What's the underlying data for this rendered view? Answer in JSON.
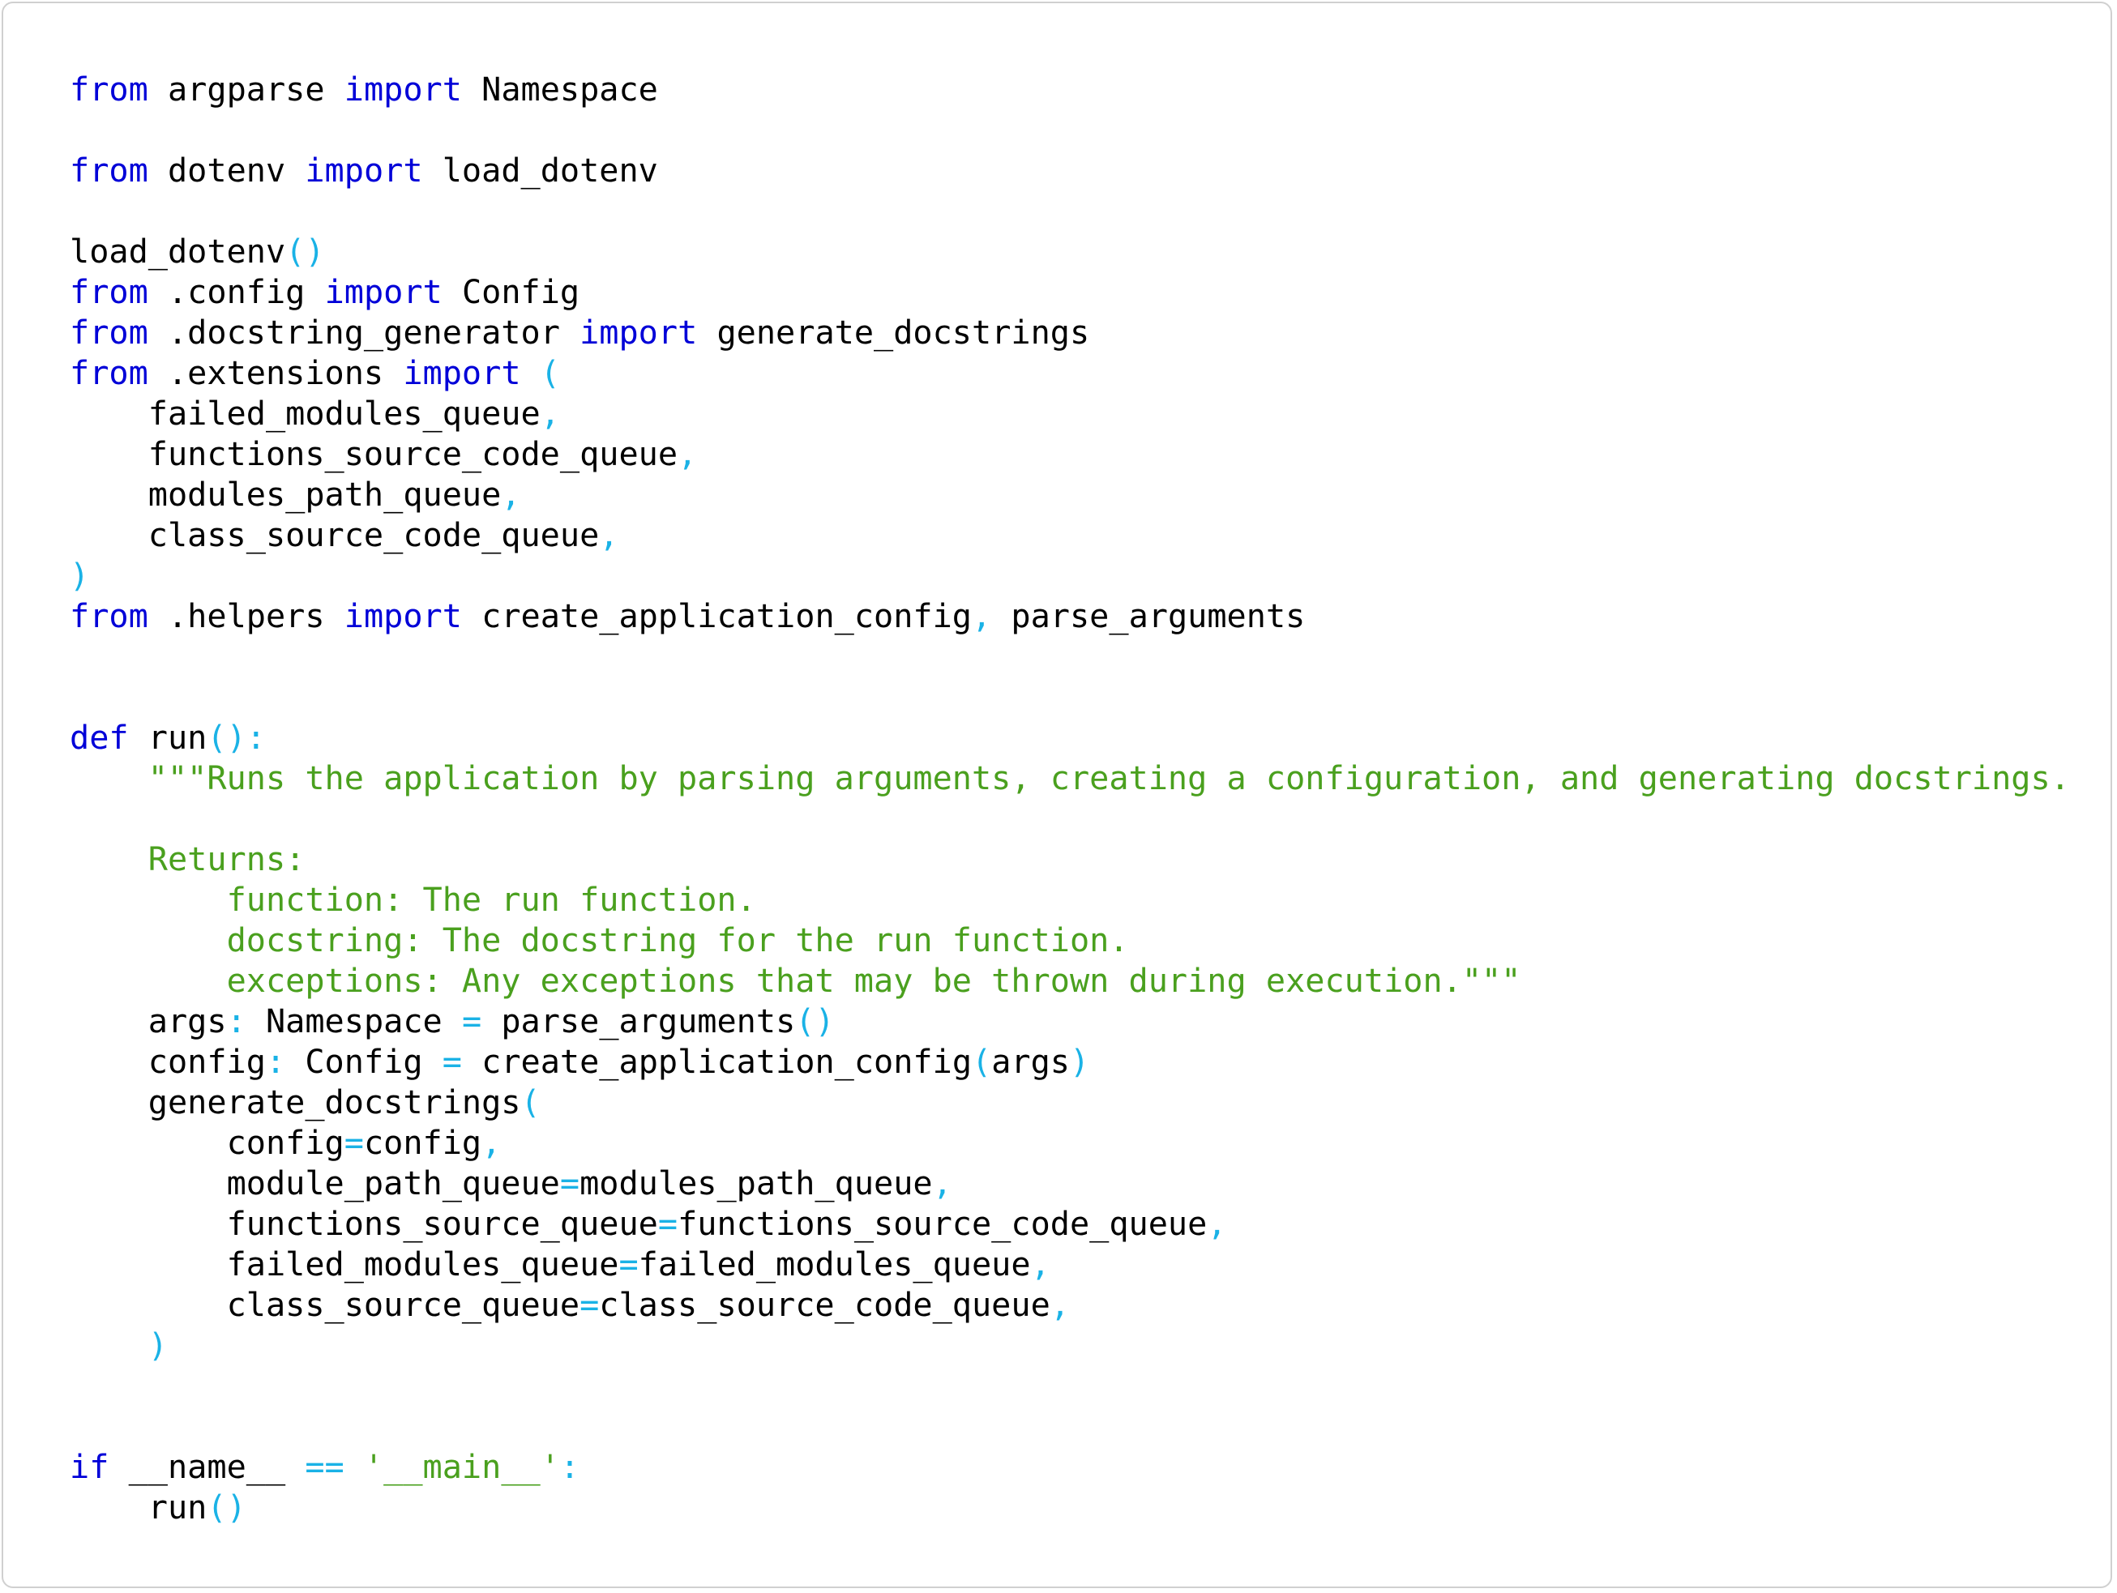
{
  "colors": {
    "keyword": "#0000d8",
    "punctuation": "#1ab2e6",
    "string": "#4aa01e",
    "identifier": "#000000",
    "background": "#ffffff",
    "border": "#d0d0d0"
  },
  "code": {
    "language": "python",
    "lines": [
      [
        [
          "kw",
          "from"
        ],
        [
          "ws",
          " "
        ],
        [
          "id",
          "argparse"
        ],
        [
          "ws",
          " "
        ],
        [
          "kw",
          "import"
        ],
        [
          "ws",
          " "
        ],
        [
          "id",
          "Namespace"
        ]
      ],
      [],
      [
        [
          "kw",
          "from"
        ],
        [
          "ws",
          " "
        ],
        [
          "id",
          "dotenv"
        ],
        [
          "ws",
          " "
        ],
        [
          "kw",
          "import"
        ],
        [
          "ws",
          " "
        ],
        [
          "id",
          "load_dotenv"
        ]
      ],
      [],
      [
        [
          "id",
          "load_dotenv"
        ],
        [
          "punc",
          "()"
        ]
      ],
      [
        [
          "kw",
          "from"
        ],
        [
          "ws",
          " "
        ],
        [
          "id",
          ".config"
        ],
        [
          "ws",
          " "
        ],
        [
          "kw",
          "import"
        ],
        [
          "ws",
          " "
        ],
        [
          "id",
          "Config"
        ]
      ],
      [
        [
          "kw",
          "from"
        ],
        [
          "ws",
          " "
        ],
        [
          "id",
          ".docstring_generator"
        ],
        [
          "ws",
          " "
        ],
        [
          "kw",
          "import"
        ],
        [
          "ws",
          " "
        ],
        [
          "id",
          "generate_docstrings"
        ]
      ],
      [
        [
          "kw",
          "from"
        ],
        [
          "ws",
          " "
        ],
        [
          "id",
          ".extensions"
        ],
        [
          "ws",
          " "
        ],
        [
          "kw",
          "import"
        ],
        [
          "ws",
          " "
        ],
        [
          "punc",
          "("
        ]
      ],
      [
        [
          "ws",
          "    "
        ],
        [
          "id",
          "failed_modules_queue"
        ],
        [
          "punc",
          ","
        ]
      ],
      [
        [
          "ws",
          "    "
        ],
        [
          "id",
          "functions_source_code_queue"
        ],
        [
          "punc",
          ","
        ]
      ],
      [
        [
          "ws",
          "    "
        ],
        [
          "id",
          "modules_path_queue"
        ],
        [
          "punc",
          ","
        ]
      ],
      [
        [
          "ws",
          "    "
        ],
        [
          "id",
          "class_source_code_queue"
        ],
        [
          "punc",
          ","
        ]
      ],
      [
        [
          "punc",
          ")"
        ]
      ],
      [
        [
          "kw",
          "from"
        ],
        [
          "ws",
          " "
        ],
        [
          "id",
          ".helpers"
        ],
        [
          "ws",
          " "
        ],
        [
          "kw",
          "import"
        ],
        [
          "ws",
          " "
        ],
        [
          "id",
          "create_application_config"
        ],
        [
          "punc",
          ","
        ],
        [
          "ws",
          " "
        ],
        [
          "id",
          "parse_arguments"
        ]
      ],
      [],
      [],
      [
        [
          "kw",
          "def"
        ],
        [
          "ws",
          " "
        ],
        [
          "id",
          "run"
        ],
        [
          "punc",
          "():"
        ]
      ],
      [
        [
          "ws",
          "    "
        ],
        [
          "str",
          "\"\"\"Runs the application by parsing arguments, creating a configuration, and generating docstrings."
        ]
      ],
      [],
      [
        [
          "ws",
          "    "
        ],
        [
          "str",
          "Returns:"
        ]
      ],
      [
        [
          "ws",
          "        "
        ],
        [
          "str",
          "function: The run function."
        ]
      ],
      [
        [
          "ws",
          "        "
        ],
        [
          "str",
          "docstring: The docstring for the run function."
        ]
      ],
      [
        [
          "ws",
          "        "
        ],
        [
          "str",
          "exceptions: Any exceptions that may be thrown during execution.\"\"\""
        ]
      ],
      [
        [
          "ws",
          "    "
        ],
        [
          "id",
          "args"
        ],
        [
          "punc",
          ":"
        ],
        [
          "ws",
          " "
        ],
        [
          "id",
          "Namespace"
        ],
        [
          "ws",
          " "
        ],
        [
          "punc",
          "="
        ],
        [
          "ws",
          " "
        ],
        [
          "id",
          "parse_arguments"
        ],
        [
          "punc",
          "()"
        ]
      ],
      [
        [
          "ws",
          "    "
        ],
        [
          "id",
          "config"
        ],
        [
          "punc",
          ":"
        ],
        [
          "ws",
          " "
        ],
        [
          "id",
          "Config"
        ],
        [
          "ws",
          " "
        ],
        [
          "punc",
          "="
        ],
        [
          "ws",
          " "
        ],
        [
          "id",
          "create_application_config"
        ],
        [
          "punc",
          "("
        ],
        [
          "id",
          "args"
        ],
        [
          "punc",
          ")"
        ]
      ],
      [
        [
          "ws",
          "    "
        ],
        [
          "id",
          "generate_docstrings"
        ],
        [
          "punc",
          "("
        ]
      ],
      [
        [
          "ws",
          "        "
        ],
        [
          "id",
          "config"
        ],
        [
          "punc",
          "="
        ],
        [
          "id",
          "config"
        ],
        [
          "punc",
          ","
        ]
      ],
      [
        [
          "ws",
          "        "
        ],
        [
          "id",
          "module_path_queue"
        ],
        [
          "punc",
          "="
        ],
        [
          "id",
          "modules_path_queue"
        ],
        [
          "punc",
          ","
        ]
      ],
      [
        [
          "ws",
          "        "
        ],
        [
          "id",
          "functions_source_queue"
        ],
        [
          "punc",
          "="
        ],
        [
          "id",
          "functions_source_code_queue"
        ],
        [
          "punc",
          ","
        ]
      ],
      [
        [
          "ws",
          "        "
        ],
        [
          "id",
          "failed_modules_queue"
        ],
        [
          "punc",
          "="
        ],
        [
          "id",
          "failed_modules_queue"
        ],
        [
          "punc",
          ","
        ]
      ],
      [
        [
          "ws",
          "        "
        ],
        [
          "id",
          "class_source_queue"
        ],
        [
          "punc",
          "="
        ],
        [
          "id",
          "class_source_code_queue"
        ],
        [
          "punc",
          ","
        ]
      ],
      [
        [
          "ws",
          "    "
        ],
        [
          "punc",
          ")"
        ]
      ],
      [],
      [],
      [
        [
          "kw",
          "if"
        ],
        [
          "ws",
          " "
        ],
        [
          "id",
          "__name__"
        ],
        [
          "ws",
          " "
        ],
        [
          "punc",
          "=="
        ],
        [
          "ws",
          " "
        ],
        [
          "str",
          "'__main__'"
        ],
        [
          "punc",
          ":"
        ]
      ],
      [
        [
          "ws",
          "    "
        ],
        [
          "id",
          "run"
        ],
        [
          "punc",
          "()"
        ]
      ]
    ]
  }
}
